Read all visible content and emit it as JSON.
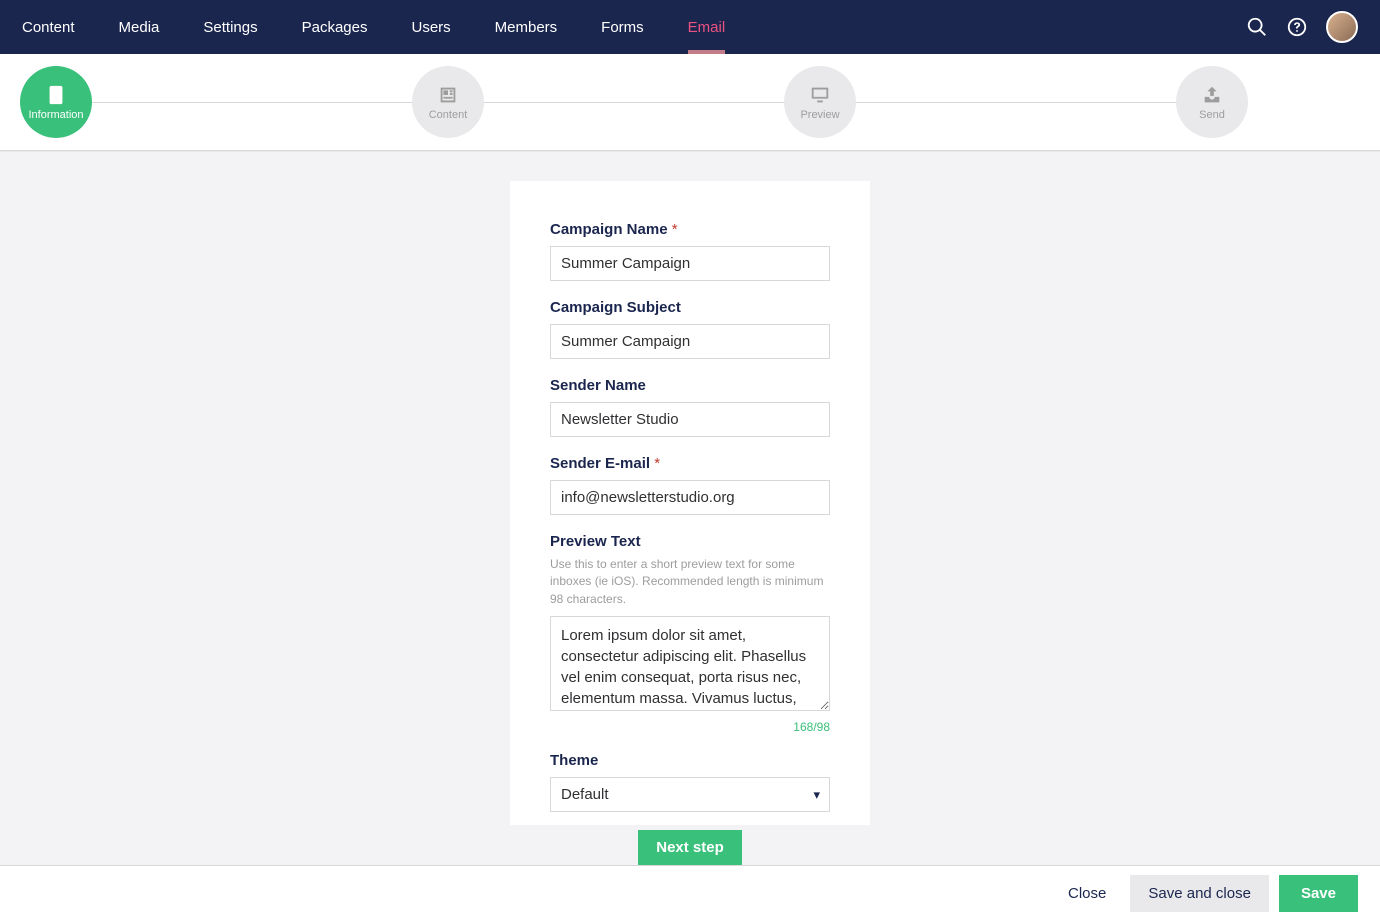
{
  "nav": {
    "items": [
      {
        "label": "Content"
      },
      {
        "label": "Media"
      },
      {
        "label": "Settings"
      },
      {
        "label": "Packages"
      },
      {
        "label": "Users"
      },
      {
        "label": "Members"
      },
      {
        "label": "Forms"
      },
      {
        "label": "Email"
      }
    ],
    "activeIndex": 7
  },
  "steps": [
    {
      "label": "Information",
      "icon": "clipboard",
      "active": true
    },
    {
      "label": "Content",
      "icon": "newspaper",
      "active": false
    },
    {
      "label": "Preview",
      "icon": "monitor",
      "active": false
    },
    {
      "label": "Send",
      "icon": "outbox",
      "active": false
    }
  ],
  "form": {
    "campaign_name_label": "Campaign Name",
    "campaign_name_value": "Summer Campaign",
    "campaign_subject_label": "Campaign Subject",
    "campaign_subject_value": "Summer Campaign",
    "sender_name_label": "Sender Name",
    "sender_name_value": "Newsletter Studio",
    "sender_email_label": "Sender E-mail",
    "sender_email_value": "info@newsletterstudio.org",
    "preview_text_label": "Preview Text",
    "preview_text_help": "Use this to enter a short preview text for some inboxes (ie iOS). Recommended length is minimum 98 characters.",
    "preview_text_value": "Lorem ipsum dolor sit amet, consectetur adipiscing elit. Phasellus vel enim consequat, porta risus nec, elementum massa. Vivamus luctus, nisl faucibus egestas dapibus,.",
    "preview_text_counter": "168/98",
    "theme_label": "Theme",
    "theme_value": "Default",
    "next_button_label": "Next step",
    "required_mark": "*"
  },
  "footer": {
    "close": "Close",
    "save_and_close": "Save and close",
    "save": "Save"
  }
}
